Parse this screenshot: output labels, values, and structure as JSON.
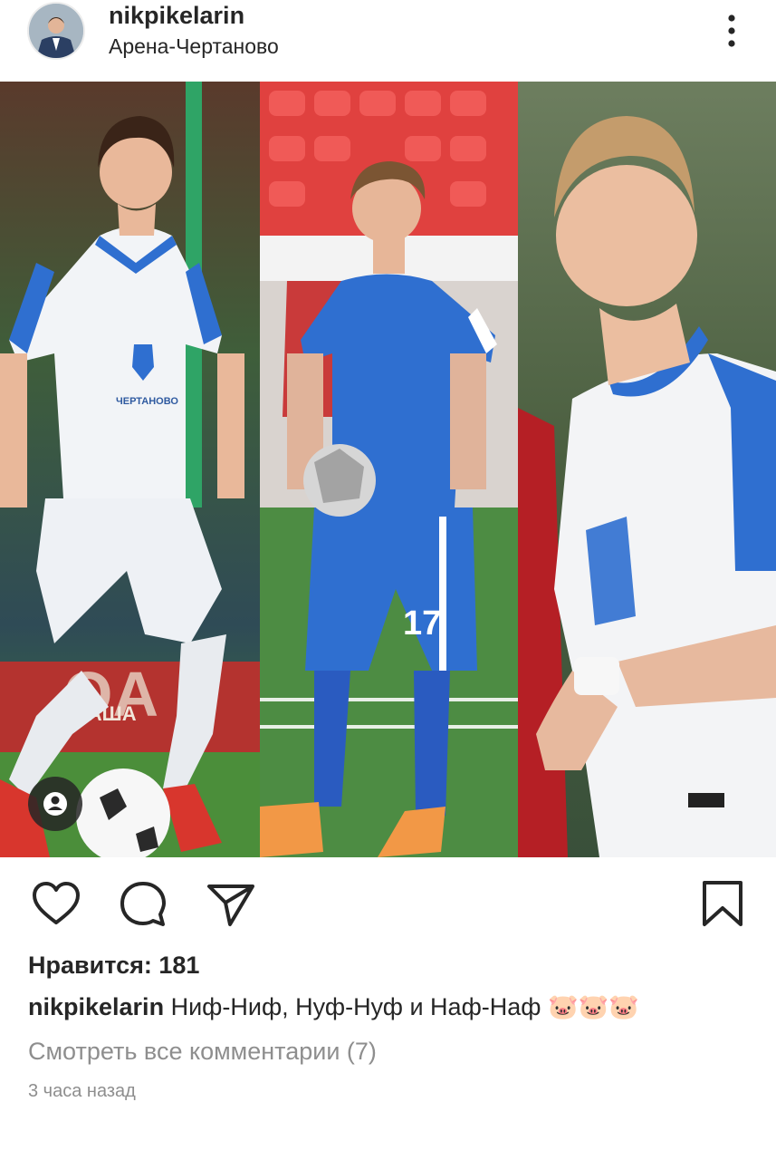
{
  "post": {
    "username": "nikpikelarin",
    "location": "Арена-Чертаново",
    "likes_label": "Нравится: 181",
    "caption_username": "nikpikelarin",
    "caption_text": "Ниф-Ниф, Нуф-Нуф и Наф-Наф",
    "caption_emoji": "🐷🐷🐷",
    "view_comments_label": "Смотреть все комментарии (7)",
    "timestamp": "3 часа назад"
  },
  "photo": {
    "jersey_text_left": "ЧЕРТАНОВО",
    "shirt_number": "17",
    "ad_text": "ВАША"
  },
  "icons": {
    "more": "more-vertical-icon",
    "user_tag": "user-tag-icon",
    "like": "heart-icon",
    "comment": "comment-icon",
    "share": "send-icon",
    "save": "bookmark-icon"
  },
  "colors": {
    "text": "#262626",
    "secondary_text": "#8e8e8e",
    "jersey_blue": "#2f6fd0",
    "seat_red": "#e0413f"
  }
}
